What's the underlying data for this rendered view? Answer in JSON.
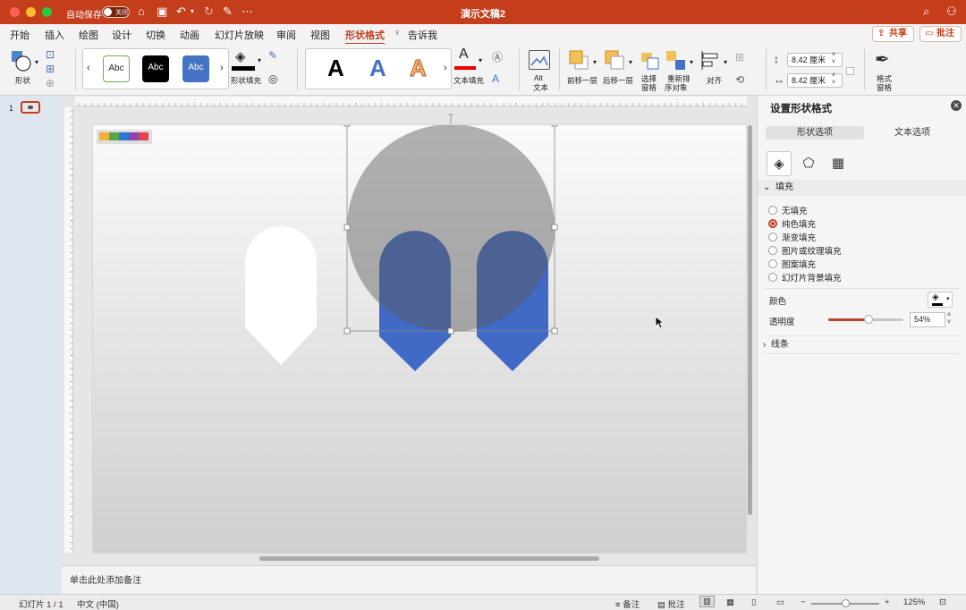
{
  "titlebar": {
    "autosave_label": "自动保存",
    "autosave_state": "关闭",
    "document_title": "演示文稿2",
    "icons": [
      "home-icon",
      "save-icon",
      "undo-icon",
      "redo-icon",
      "edit-icon",
      "more-icon",
      "search-icon",
      "account-icon"
    ]
  },
  "tabs": [
    "开始",
    "插入",
    "绘图",
    "设计",
    "切换",
    "动画",
    "幻灯片放映",
    "审阅",
    "视图",
    "形状格式",
    "告诉我"
  ],
  "active_tab": "形状格式",
  "top_buttons": {
    "share": "共享",
    "comment": "批注"
  },
  "ribbon": {
    "shape_label": "形状",
    "style_samples": [
      "Abc",
      "Abc",
      "Abc"
    ],
    "shape_fill_label": "形状填充",
    "wordart_samples": [
      "A",
      "A",
      "A"
    ],
    "text_fill_label": "文本填充",
    "alt_text_label_1": "Alt",
    "alt_text_label_2": "文本",
    "bring_forward": "前移一层",
    "send_backward": "后移一层",
    "selection_pane_1": "选择",
    "selection_pane_2": "窗格",
    "reorder_1": "重新排",
    "reorder_2": "序对象",
    "align": "对齐",
    "height_value": "8.42 厘米",
    "width_value": "8.42 厘米",
    "format_pane_1": "格式",
    "format_pane_2": "窗格"
  },
  "thumbnails": {
    "slide_number": "1"
  },
  "slide": {
    "color_strip": [
      "#f2b134",
      "#55a84b",
      "#2e75d6",
      "#8e44ad",
      "#e7414a"
    ],
    "circle_color": "#5a5a5a",
    "circle_opacity": 0.46,
    "blue_color": "#4169c6",
    "white_shape_color": "#ffffff"
  },
  "notes_placeholder": "单击此处添加备注",
  "format_panel": {
    "title": "设置形状格式",
    "tab_shape": "形状选项",
    "tab_text": "文本选项",
    "icons": [
      "fill-line-icon",
      "effects-icon",
      "size-properties-icon"
    ],
    "fill_section": "填充",
    "fill_options": [
      "无填充",
      "纯色填充",
      "渐变填充",
      "图片或纹理填充",
      "图案填充",
      "幻灯片背景填充"
    ],
    "selected_fill": "纯色填充",
    "color_label": "颜色",
    "transparency_label": "透明度",
    "transparency_value": "54%",
    "transparency_fraction": 0.54,
    "line_section": "线条"
  },
  "statusbar": {
    "slide_info": "幻灯片 1 / 1",
    "language": "中文 (中国)",
    "notes": "备注",
    "comments": "批注",
    "zoom": "125%"
  }
}
